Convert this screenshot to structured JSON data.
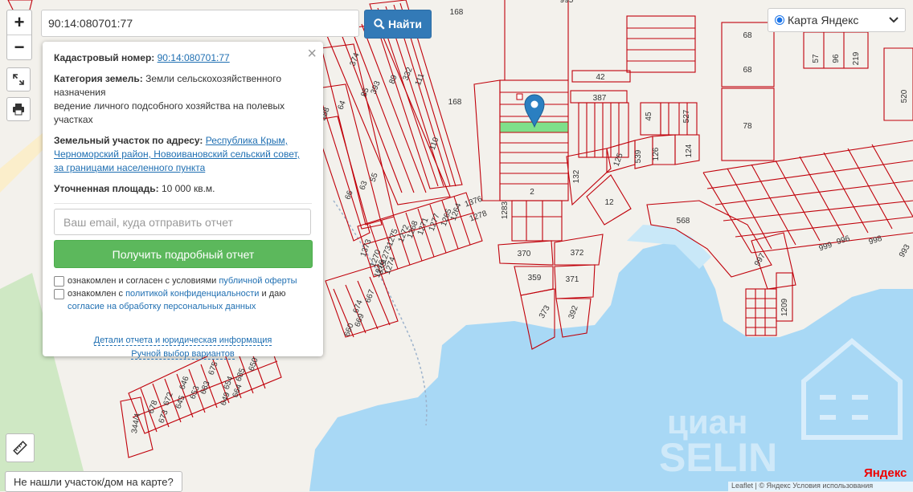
{
  "search": {
    "value": "90:14:080701:77",
    "button_label": "Найти"
  },
  "zoom": {
    "in_label": "+",
    "out_label": "−"
  },
  "controls": {
    "fullscreen_icon": "expand-icon",
    "print_icon": "printer-icon",
    "ruler_icon": "ruler-icon"
  },
  "layer": {
    "selected": "Карта Яндекс"
  },
  "panel": {
    "cadastral_label": "Кадастровый номер:",
    "cadastral_value": "90:14:080701:77",
    "category_label": "Категория земель:",
    "category_value": "Земли сельскохозяйственного назначения",
    "usage_value": "ведение личного подсобного хозяйства на полевых участках",
    "address_label": "Земельный участок по адресу:",
    "address_value": "Республика Крым, Черноморский район, Новоивановский сельский совет, за границами населенного пункта",
    "area_label": "Уточненная площадь:",
    "area_value": "10 000 кв.м.",
    "email_placeholder": "Ваш email, куда отправить отчет",
    "report_button": "Получить подробный отчет",
    "consent1_text": "ознакомлен и согласен с условиями",
    "consent1_link": "публичной оферты",
    "consent2_text": "ознакомлен с",
    "consent2_link": "политикой конфиденциальности",
    "consent2_tail": "и даю",
    "consent2_link2": "согласие на обработку персональных данных",
    "details_link": "Детали отчета и юридическая информация",
    "manual_link": "Ручной выбор вариантов"
  },
  "not_found": "Не нашли участок/дом на карте?",
  "provider": "Яндекс",
  "attribution": "Leaflet | © Яндекс  Условия использования",
  "map": {
    "parcel_line_color": "#c0000a",
    "highlight_color": "#7ee08a",
    "water_color": "#a8d8f5",
    "land_color": "#f3f1ec",
    "field_color": "#cfe8c4",
    "labels": [
      "995",
      "168",
      "168",
      "42",
      "387",
      "45",
      "527",
      "78",
      "68",
      "68",
      "57",
      "96",
      "219",
      "520",
      "125",
      "539",
      "126",
      "124",
      "132",
      "12",
      "2",
      "568",
      "1283",
      "370",
      "372",
      "359",
      "371",
      "373",
      "392",
      "999",
      "996",
      "998",
      "993",
      "997",
      "1209",
      "1376",
      "1278",
      "1264",
      "1265",
      "1277",
      "1271",
      "1268",
      "1272",
      "1275",
      "1273",
      "1270",
      "1276",
      "1274",
      "1373",
      "110",
      "111",
      "332",
      "89",
      "393",
      "85",
      "374",
      "64",
      "388",
      "55",
      "63",
      "66",
      "335",
      "674",
      "667",
      "669",
      "660",
      "650",
      "646",
      "675",
      "683",
      "672",
      "654",
      "673",
      "678",
      "645",
      "653",
      "685",
      "649",
      "664",
      "344/4"
    ]
  }
}
